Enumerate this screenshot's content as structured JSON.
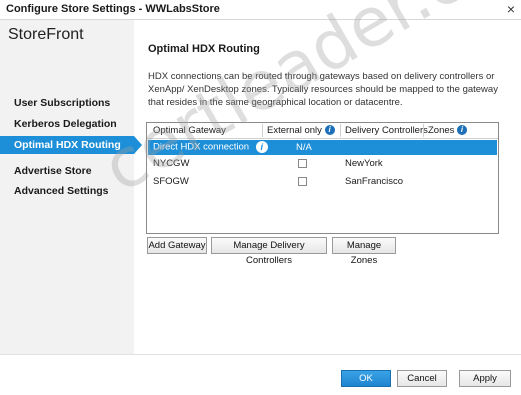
{
  "window": {
    "title": "Configure Store Settings - WWLabsStore",
    "close_glyph": "×"
  },
  "app": {
    "title": "StoreFront"
  },
  "sidebar": {
    "items": [
      {
        "label": "User Subscriptions",
        "active": false
      },
      {
        "label": "Kerberos Delegation",
        "active": false
      },
      {
        "label": "Optimal HDX Routing",
        "active": true
      },
      {
        "label": "Advertise Store",
        "active": false
      },
      {
        "label": "Advanced Settings",
        "active": false
      }
    ]
  },
  "main": {
    "title": "Optimal HDX Routing",
    "description": "HDX connections can be routed through gateways based on delivery controllers or XenApp/ XenDesktop zones. Typically resources should be mapped to the gateway that resides in the same geographical location or datacentre."
  },
  "table": {
    "headers": {
      "gateway": "Optimal Gateway",
      "external": "External only",
      "controllers": "Delivery Controllers",
      "zones": "Zones"
    },
    "info_glyph": "i",
    "rows": [
      {
        "gateway": "Direct HDX connection",
        "external": "N/A",
        "controllers": "",
        "zones": "",
        "selected": true
      },
      {
        "gateway": "NYCGW",
        "external": "",
        "controllers": "NewYork",
        "zones": "",
        "selected": false
      },
      {
        "gateway": "SFOGW",
        "external": "",
        "controllers": "SanFrancisco",
        "zones": "",
        "selected": false
      }
    ]
  },
  "actions": {
    "add_gateway": "Add Gateway",
    "manage_controllers": "Manage Delivery Controllers",
    "manage_zones": "Manage Zones"
  },
  "footer": {
    "ok": "OK",
    "cancel": "Cancel",
    "apply": "Apply"
  },
  "watermark": "certleader.com",
  "colors": {
    "accent": "#1d8fd8",
    "sidebar_bg": "#f2f2f2"
  }
}
